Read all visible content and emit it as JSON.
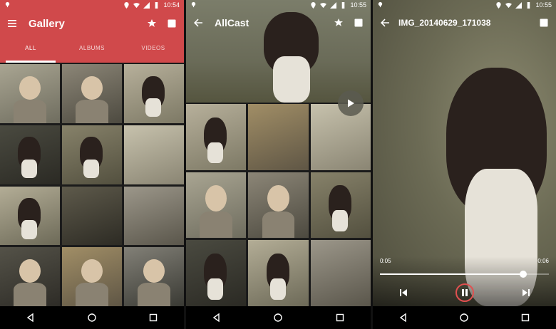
{
  "screens": [
    {
      "status": {
        "time": "10:54"
      },
      "toolbar": {
        "title": "Gallery",
        "menu_icon": "menu-icon",
        "star_icon": "star-icon",
        "cast_icon": "cast-icon"
      },
      "tabs": [
        {
          "label": "ALL",
          "active": true
        },
        {
          "label": "ALBUMS",
          "active": false
        },
        {
          "label": "VIDEOS",
          "active": false
        }
      ]
    },
    {
      "status": {
        "time": "10:55"
      },
      "toolbar": {
        "title": "AllCast",
        "back_icon": "back-arrow-icon",
        "star_icon": "star-icon",
        "cast_icon": "cast-icon"
      },
      "fab": {
        "icon": "play-icon"
      }
    },
    {
      "status": {
        "time": "10:55"
      },
      "toolbar": {
        "title": "IMG_20140629_171038",
        "back_icon": "back-arrow-icon",
        "cast_icon": "cast-icon"
      },
      "player": {
        "current_time": "0:05",
        "total_time": "0:06",
        "progress": 0.85,
        "prev_icon": "skip-previous-icon",
        "pause_icon": "pause-icon",
        "next_icon": "skip-next-icon"
      }
    }
  ],
  "nav": {
    "back_icon": "nav-back-icon",
    "home_icon": "nav-home-icon",
    "recents_icon": "nav-recents-icon"
  },
  "colors": {
    "accent": "#d0494b",
    "pause_ring": "#e05050"
  }
}
